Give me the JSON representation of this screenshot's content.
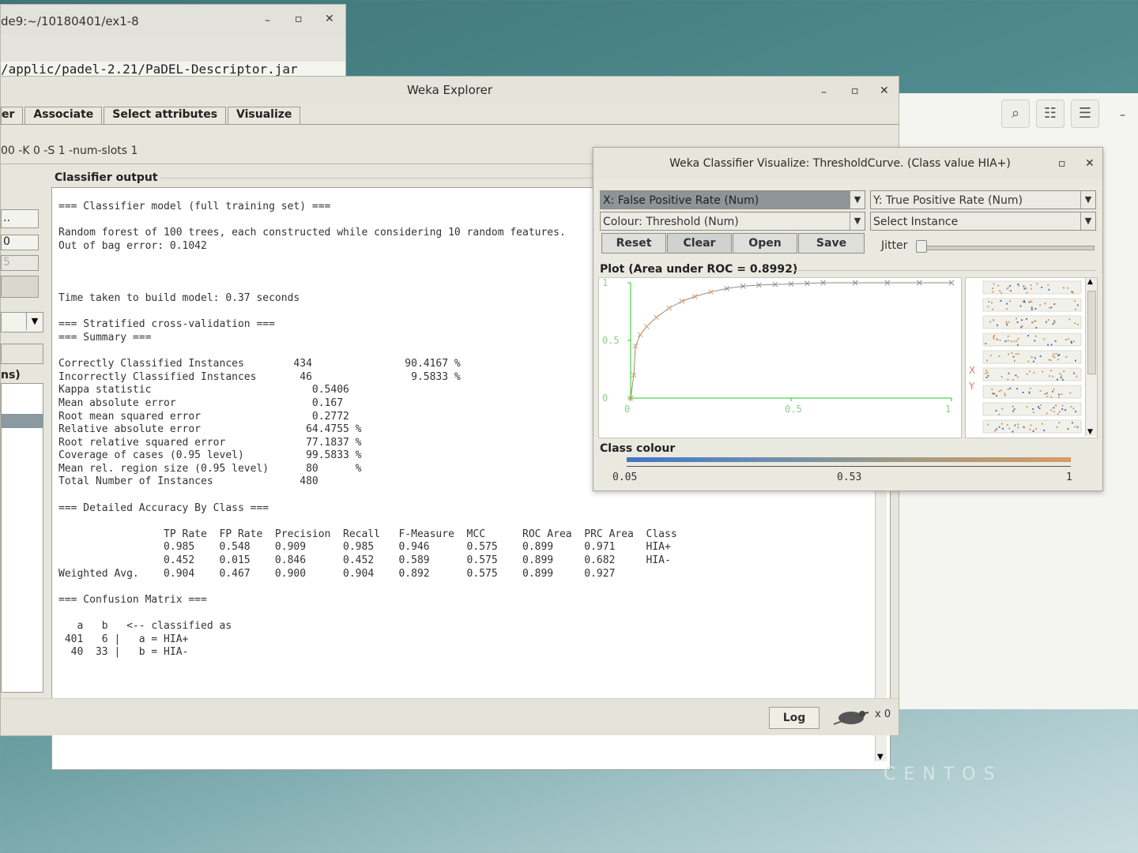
{
  "terminal": {
    "path": "de9:~/10180401/ex1-8",
    "command": "/applic/padel-2.21/PaDEL-Descriptor.jar"
  },
  "explorer": {
    "title": "Weka Explorer",
    "tabs": [
      "er",
      "Associate",
      "Select attributes",
      "Visualize"
    ],
    "classifier_config": "00 -K 0 -S 1 -num-slots 1",
    "side_fields": [
      "..",
      "0",
      "5"
    ],
    "side_label": "ns)",
    "output_label": "Classifier output",
    "output_lines": [
      "=== Classifier model (full training set) ===",
      "",
      "Random forest of 100 trees, each constructed while considering 10 random features.",
      "Out of bag error: 0.1042",
      "",
      "",
      "",
      "Time taken to build model: 0.37 seconds",
      "",
      "=== Stratified cross-validation ===",
      "=== Summary ===",
      "",
      "Correctly Classified Instances        434               90.4167 %",
      "Incorrectly Classified Instances       46                9.5833 %",
      "Kappa statistic                          0.5406",
      "Mean absolute error                      0.167",
      "Root mean squared error                  0.2772",
      "Relative absolute error                 64.4755 %",
      "Root relative squared error             77.1837 %",
      "Coverage of cases (0.95 level)          99.5833 %",
      "Mean rel. region size (0.95 level)      80      %",
      "Total Number of Instances              480",
      "",
      "=== Detailed Accuracy By Class ===",
      "",
      "                 TP Rate  FP Rate  Precision  Recall   F-Measure  MCC      ROC Area  PRC Area  Class",
      "                 0.985    0.548    0.909      0.985    0.946      0.575    0.899     0.971     HIA+",
      "                 0.452    0.015    0.846      0.452    0.589      0.575    0.899     0.682     HIA-",
      "Weighted Avg.    0.904    0.467    0.900      0.904    0.892      0.575    0.899     0.927",
      "",
      "=== Confusion Matrix ===",
      "",
      "   a   b   <-- classified as",
      " 401   6 |   a = HIA+",
      "  40  33 |   b = HIA-"
    ],
    "log_button": "Log",
    "status_count": "x 0"
  },
  "viz": {
    "title": "Weka Classifier Visualize: ThresholdCurve. (Class value HIA+)",
    "x_axis_select": "X: False Positive Rate (Num)",
    "y_axis_select": "Y: True Positive Rate (Num)",
    "colour_select": "Colour: Threshold (Num)",
    "instance_select": "Select Instance",
    "buttons": [
      "Reset",
      "Clear",
      "Open",
      "Save"
    ],
    "jitter_label": "Jitter",
    "jitter_value": 0,
    "plot_label": "Plot (Area under ROC = 0.8992)",
    "class_colour_label": "Class colour",
    "class_colour_ticks": [
      "0.05",
      "0.53",
      "1"
    ],
    "matrix_labels": [
      "X",
      "Y"
    ]
  },
  "chart_data": {
    "type": "line",
    "x_ticks": [
      "0",
      "0.5",
      "1"
    ],
    "y_ticks": [
      "0",
      "0.5",
      "1"
    ],
    "xlim": [
      0,
      1
    ],
    "ylim": [
      0,
      1
    ],
    "x": [
      0,
      0.01,
      0.015,
      0.03,
      0.05,
      0.08,
      0.12,
      0.16,
      0.2,
      0.25,
      0.3,
      0.35,
      0.4,
      0.45,
      0.5,
      0.55,
      0.6,
      0.7,
      0.8,
      0.9,
      1.0
    ],
    "y": [
      0,
      0.2,
      0.45,
      0.55,
      0.62,
      0.7,
      0.78,
      0.84,
      0.88,
      0.92,
      0.95,
      0.97,
      0.98,
      0.985,
      0.99,
      0.995,
      1.0,
      1.0,
      1.0,
      1.0,
      1.0
    ],
    "colors": {
      "low": "#4076c8",
      "high": "#d99b66",
      "axis": "#22cc22",
      "tick_text": "#8ccf8c"
    }
  },
  "desktop": {
    "brand": "CENTOS"
  }
}
